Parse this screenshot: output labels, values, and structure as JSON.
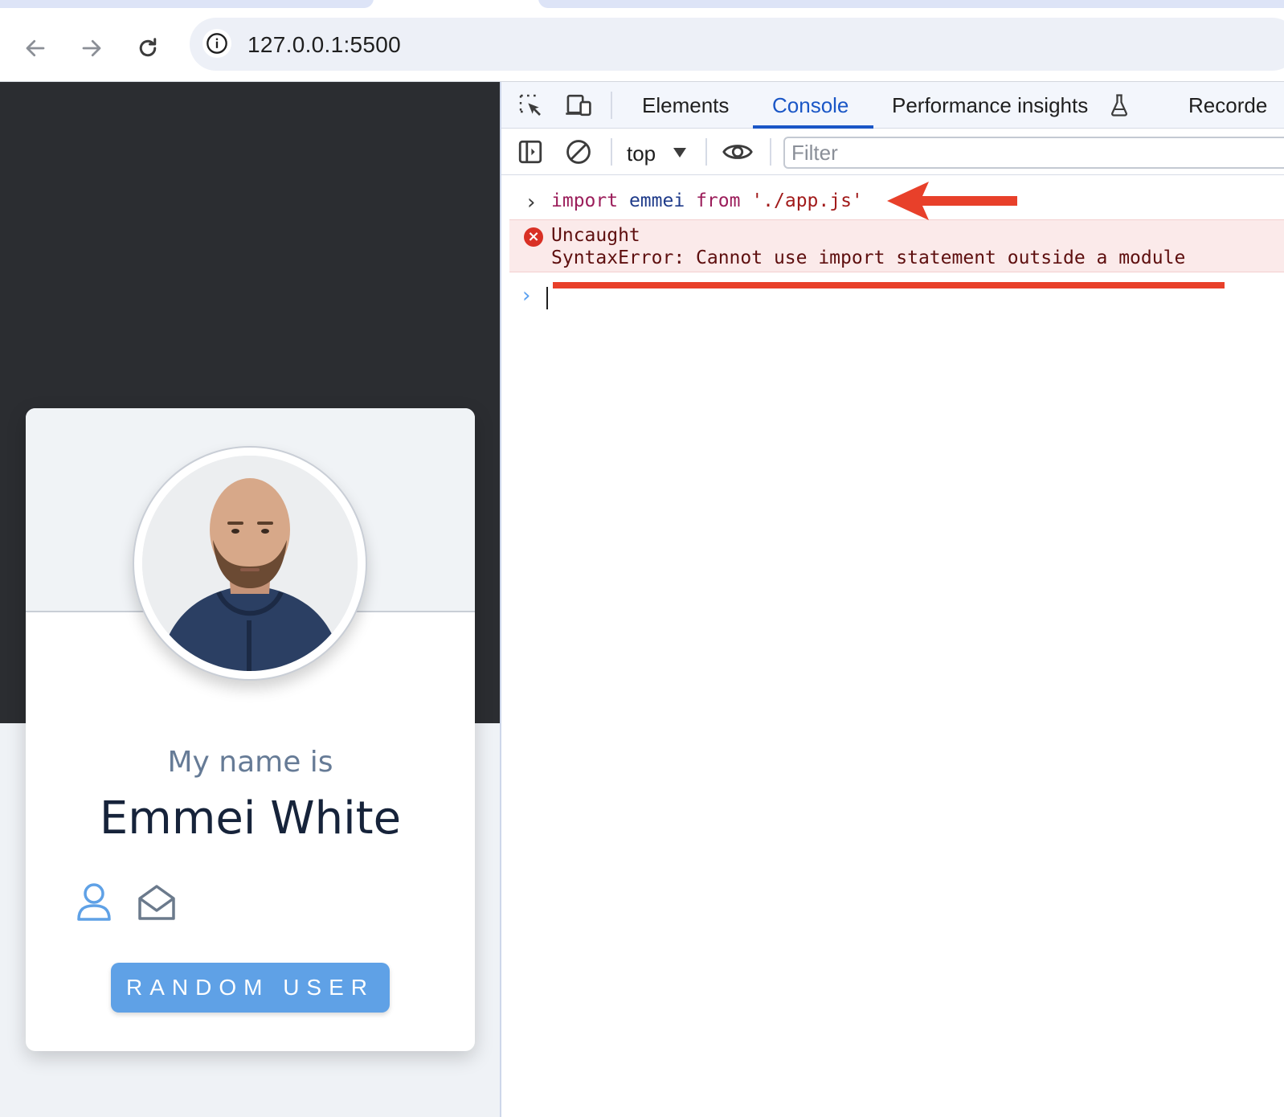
{
  "browser": {
    "url": "127.0.0.1:5500",
    "back_icon": "arrow-left-icon",
    "forward_icon": "arrow-right-icon",
    "reload_icon": "reload-icon",
    "site_info_icon": "info-icon"
  },
  "page": {
    "greeting": "My name is",
    "name": "Emmei White",
    "button_label": "RANDOM USER",
    "icons": [
      "user-icon",
      "mail-open-icon"
    ],
    "colors": {
      "accent": "#5fa1e6",
      "dark_bg": "#2b2d31",
      "name_text": "#16233a",
      "greeting_text": "#667b96"
    }
  },
  "devtools": {
    "tabs": [
      {
        "label": "Elements",
        "active": false
      },
      {
        "label": "Console",
        "active": true
      },
      {
        "label": "Performance insights",
        "active": false
      },
      {
        "label": "Recorde",
        "active": false
      }
    ],
    "toolbar": {
      "context": "top",
      "filter_placeholder": "Filter"
    },
    "console": {
      "input_line": {
        "kw1": "import",
        "ident": "emmei",
        "kw2": "from",
        "str": "'./app.js'"
      },
      "error": {
        "line1": "Uncaught",
        "line2": "SyntaxError: Cannot use import statement outside a module"
      }
    },
    "colors": {
      "active_tab": "#1a56c6",
      "error_bg": "#fbeaea",
      "error_icon": "#d93025"
    }
  },
  "annotations": {
    "color": "#e8402a"
  }
}
